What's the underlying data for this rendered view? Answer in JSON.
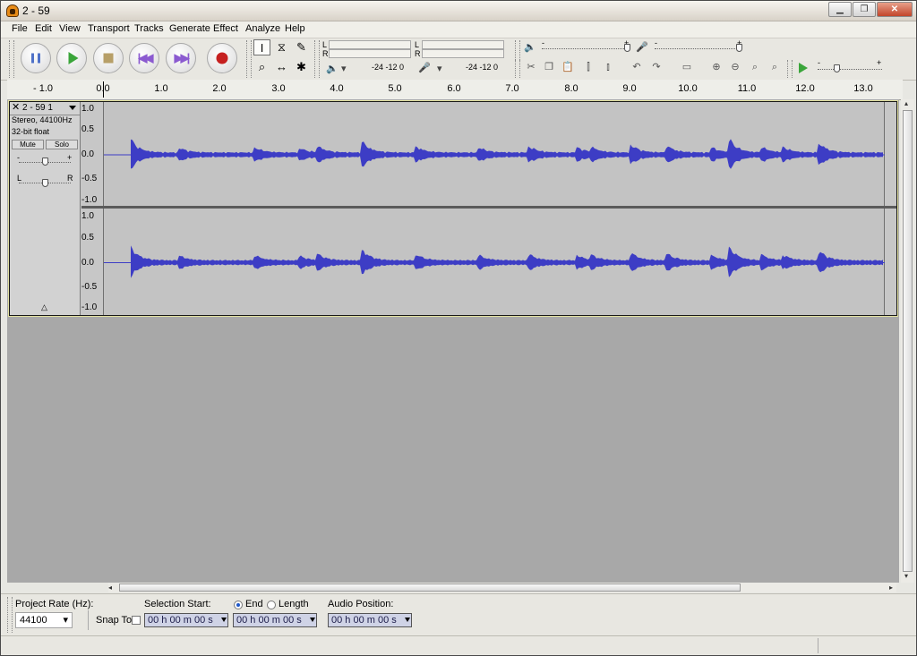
{
  "window": {
    "title": "2 - 59",
    "minimize_glyph": "▁",
    "maximize_glyph": "❐",
    "close_glyph": "✕"
  },
  "menu": [
    "File",
    "Edit",
    "View",
    "Transport",
    "Tracks",
    "Generate",
    "Effect",
    "Analyze",
    "Help"
  ],
  "meters": {
    "left_label": "L",
    "right_label": "R",
    "play_scale": "-24  -12   0",
    "rec_scale": "-24  -12   0",
    "minus": "-",
    "plus": "+"
  },
  "ruler": {
    "ticks": [
      "- 1.0",
      "0.0",
      "1.0",
      "2.0",
      "3.0",
      "4.0",
      "5.0",
      "6.0",
      "7.0",
      "8.0",
      "9.0",
      "10.0",
      "11.0",
      "12.0",
      "13.0"
    ],
    "cursor_value": 0.09
  },
  "track": {
    "name": "2 - 59 1",
    "format": "Stereo, 44100Hz",
    "bit_depth": "32-bit float",
    "mute_label": "Mute",
    "solo_label": "Solo",
    "gain_minus": "-",
    "gain_plus": "+",
    "pan_left": "L",
    "pan_right": "R",
    "collapse_glyph": "△",
    "close_glyph": "✕",
    "vscale": [
      "1.0",
      "0.5",
      "0.0",
      "-0.5",
      "-1.0"
    ],
    "wave_color": "#3d3dc5"
  },
  "bottom": {
    "project_rate_label": "Project Rate (Hz):",
    "project_rate": "44100",
    "snap_to_label": "Snap To",
    "selection_start_label": "Selection Start:",
    "end_label": "End",
    "length_label": "Length",
    "audio_position_label": "Audio Position:",
    "time_start": "00 h 00 m 00 s",
    "time_end": "00 h 00 m 00 s",
    "time_audio": "00 h 00 m 00 s"
  },
  "colors": {
    "waveform": "#3d3dc5",
    "selected_border": "#e2e1a0",
    "track_bg": "#c3c3c3"
  }
}
